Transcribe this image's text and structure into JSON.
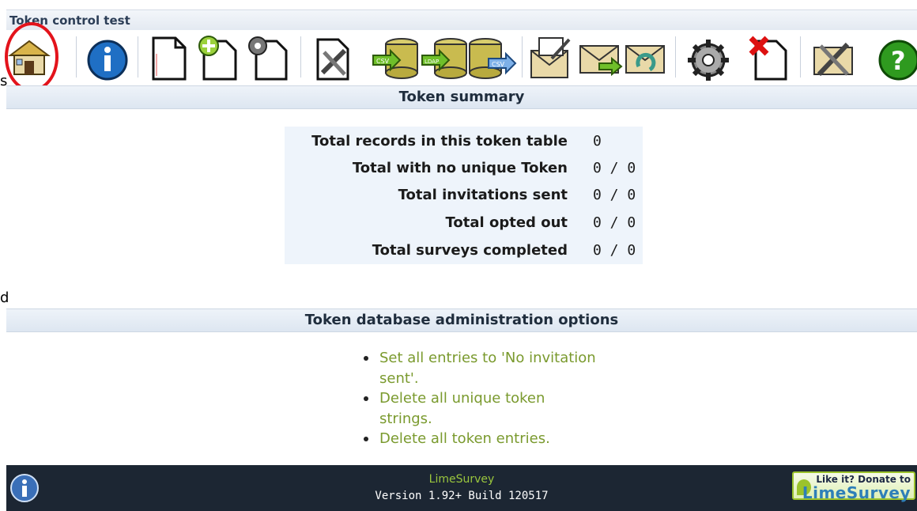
{
  "window": {
    "title": "Token control test"
  },
  "toolbar": {
    "icons": [
      "home-icon",
      "info-icon",
      "document-icon",
      "add-document-icon",
      "settings-document-icon",
      "tools-icon",
      "csv-import-icon",
      "ldap-import-icon",
      "csv-export-icon",
      "invite-icon",
      "send-mail-icon",
      "reminder-mail-icon",
      "gear-icon",
      "delete-document-icon",
      "tools-icon",
      "help-icon"
    ]
  },
  "summary": {
    "heading": "Token summary",
    "rows": [
      {
        "label": "Total records in this token table",
        "value": "0"
      },
      {
        "label": "Total with no unique Token",
        "value": "0 / 0"
      },
      {
        "label": "Total invitations sent",
        "value": "0 / 0"
      },
      {
        "label": "Total opted out",
        "value": "0 / 0"
      },
      {
        "label": "Total surveys completed",
        "value": "0 / 0"
      }
    ]
  },
  "admin": {
    "heading": "Token database administration options",
    "options": [
      "Set all entries to 'No invitation sent'.",
      "Delete all unique token strings.",
      "Delete all token entries."
    ]
  },
  "footer": {
    "brand": "LimeSurvey",
    "version": "Version 1.92+ Build 120517",
    "donate_line1": "Like it? Donate to",
    "donate_line2": "LimeSurvey"
  },
  "edge_text": {
    "a": "s",
    "b": "d"
  },
  "colors": {
    "link": "#7a9a2e",
    "highlight": "#e3131b",
    "footer": "#1c2633"
  }
}
